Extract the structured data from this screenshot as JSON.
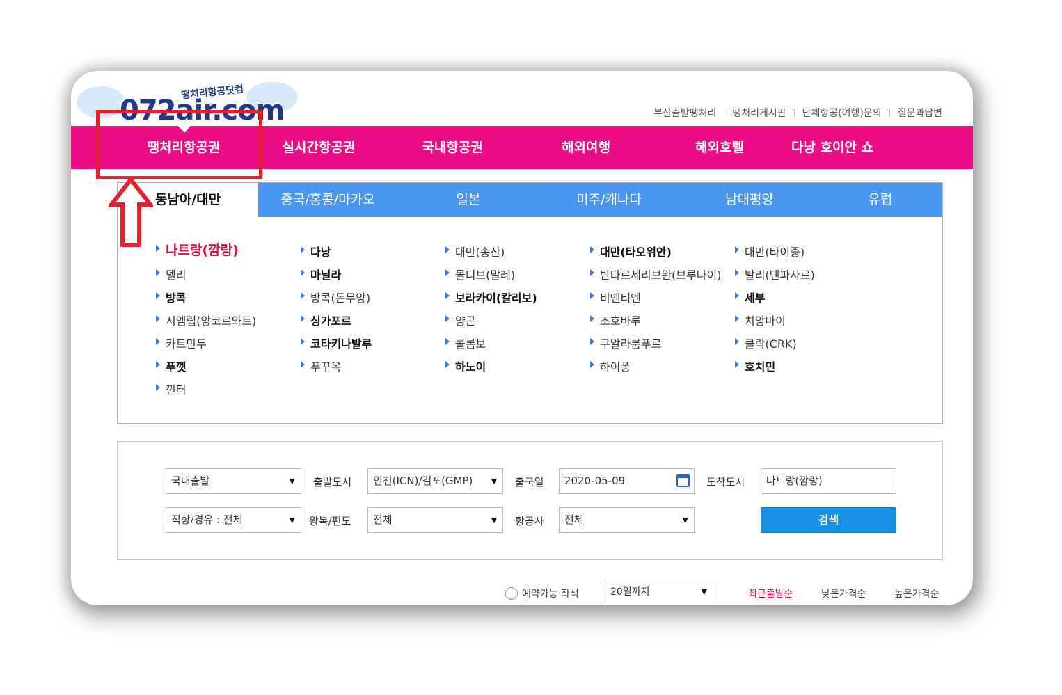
{
  "logo": {
    "brand": "072air.com",
    "subtitle": "땡처리항공닷컴"
  },
  "top_menu": [
    "부산출발땡처리",
    "땡처리게시판",
    "단체항공(여행)문의",
    "질문과답변"
  ],
  "nav": {
    "items": [
      "땡처리항공권",
      "실시간항공권",
      "국내항공권",
      "해외여행",
      "해외호텔",
      "다낭 호이안 쇼"
    ],
    "accent": "#ec0c86"
  },
  "regions": {
    "tabs": [
      "동남아/대만",
      "중국/홍콩/마카오",
      "일본",
      "미주/캐나다",
      "남태평양",
      "유럽"
    ],
    "tab_color": "#4a97f2",
    "destinations": [
      [
        "나트랑(깜랑)",
        "다낭",
        "대만(송산)",
        "대만(타오위안)",
        "대만(타이중)"
      ],
      [
        "델리",
        "마닐라",
        "몰디브(말레)",
        "반다르세리브완(브루나이)",
        "발리(덴파사르)"
      ],
      [
        "방콕",
        "방콕(돈무앙)",
        "보라카이(칼리보)",
        "비엔티엔",
        "세부"
      ],
      [
        "시엠립(앙코르와트)",
        "싱가포르",
        "양곤",
        "조호바루",
        "치앙마이"
      ],
      [
        "카트만두",
        "코타키나발루",
        "콜롬보",
        "쿠알라룸푸르",
        "클락(CRK)"
      ],
      [
        "푸껫",
        "푸꾸옥",
        "하노이",
        "하이퐁",
        "호치민"
      ],
      [
        "껀터"
      ]
    ]
  },
  "search": {
    "departure_type": "국내출발",
    "departure_city_label": "출발도시",
    "departure_city": "인천(ICN)/김포(GMP)",
    "date_label": "출국일",
    "date": "2020-05-09",
    "arrival_city_label": "도착도시",
    "arrival_city": "나트랑(깜랑)",
    "route_type": "직항/경유 : 전체",
    "trip_label": "왕복/편도",
    "trip": "전체",
    "airline_label": "항공사",
    "airline": "전체",
    "search_button": "검색",
    "button_color": "#1592e6"
  },
  "bottom": {
    "available_seats": "예약가능 좌석",
    "period": "20일까지",
    "sort": [
      "최근출발순",
      "낮은가격순",
      "높은가격순"
    ]
  },
  "icons": {
    "dropdown": "▼",
    "calendar": "calendar-icon",
    "annotation_arrow": "up-arrow-icon"
  },
  "annotation_color": "#e3202d"
}
